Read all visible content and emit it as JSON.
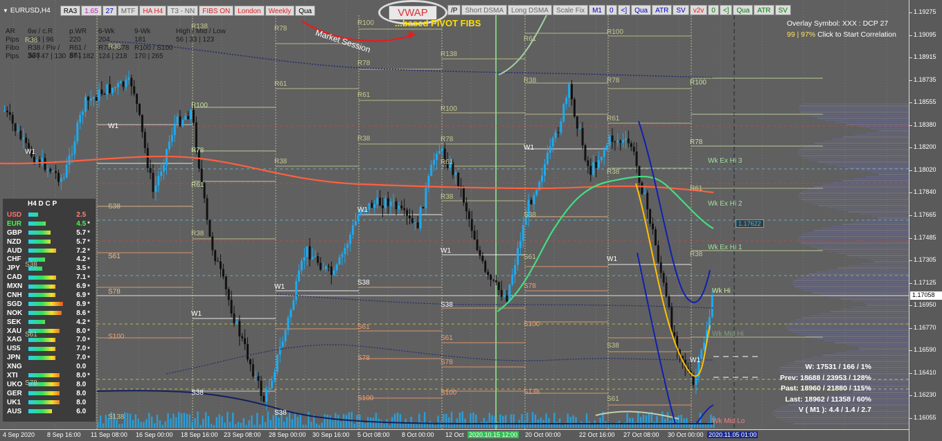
{
  "symbol": {
    "name": "EURUSD,H4"
  },
  "toolbar": {
    "items": [
      {
        "label": "RA3",
        "color": "#000000"
      },
      {
        "label": "1.65",
        "color": "#c020c0"
      },
      {
        "label": "27",
        "color": "#0000c0"
      },
      {
        "label": "MTF",
        "color": "#666666"
      },
      {
        "label": "HA H4",
        "color": "#e02020"
      },
      {
        "label": "T3 - NN",
        "color": "#666666"
      },
      {
        "label": "FIBS ON",
        "color": "#e02020"
      },
      {
        "label": "London",
        "color": "#e02020"
      },
      {
        "label": "Weekly",
        "color": "#e02020"
      },
      {
        "label": "Qua",
        "color": "#000000"
      }
    ],
    "items_right": [
      {
        "label": "/P",
        "color": "#000000"
      },
      {
        "label": "Short DSMA",
        "color": "#666666"
      },
      {
        "label": "Long DSMA",
        "color": "#666666"
      },
      {
        "label": "Scale Fix",
        "color": "#666666"
      },
      {
        "label": "M1",
        "color": "#0000c0"
      },
      {
        "label": "0",
        "color": "#0000c0"
      },
      {
        "label": "<]",
        "color": "#0000c0"
      },
      {
        "label": "Qua",
        "color": "#0000c0"
      },
      {
        "label": "ATR",
        "color": "#0000c0"
      },
      {
        "label": "SV",
        "color": "#0000c0"
      },
      {
        "label": "v2v",
        "color": "#e02020"
      },
      {
        "label": "0",
        "color": "#008000"
      },
      {
        "label": "<]",
        "color": "#008000"
      },
      {
        "label": "Qua",
        "color": "#008000"
      },
      {
        "label": "ATR",
        "color": "#008000"
      },
      {
        "label": "SV",
        "color": "#008000"
      }
    ],
    "vwap_label": "VWAP"
  },
  "annotations": {
    "market_session": "Market Session",
    "based_pivot": "...based PIVOT FIBS"
  },
  "overlay": {
    "line1": "Overlay Symbol: XXX : DCP 27",
    "line2_pct": "99 | 97%",
    "line2_text": "Click to Start Correlation"
  },
  "stats": {
    "rows": [
      [
        "AR",
        "6w / c.R",
        "p.WR",
        "6-Wk",
        "9-Wk",
        "High / Mid / Low"
      ],
      [
        "Pips",
        "R38 | 96",
        "220",
        "204",
        "181",
        "56 | 33 | 123"
      ],
      [
        "Fibo",
        "R38 / Piv / S38",
        "R61 / S61",
        "R78 / S78",
        "R100 / S100",
        ""
      ],
      [
        "Pips",
        "36 | 47 | 130",
        "87 | 182",
        "124 | 218",
        "170 | 265",
        ""
      ]
    ]
  },
  "dcp": {
    "header": "H4  D C P",
    "currencies": [
      {
        "name": "USD",
        "value": "2.5",
        "star": "",
        "name_color": "#ff7070",
        "fill": 0.25
      },
      {
        "name": "EUR",
        "value": "4.5",
        "star": "*",
        "name_color": "#40ff40",
        "fill": 0.45
      },
      {
        "name": "GBP",
        "value": "5.7",
        "star": "*",
        "name_color": "#ffffff",
        "fill": 0.57
      },
      {
        "name": "NZD",
        "value": "5.7",
        "star": "*",
        "name_color": "#ffffff",
        "fill": 0.57
      },
      {
        "name": "AUD",
        "value": "7.2",
        "star": "*",
        "name_color": "#ffffff",
        "fill": 0.72
      },
      {
        "name": "CHF",
        "value": "4.2",
        "star": "*",
        "name_color": "#ffffff",
        "fill": 0.42
      },
      {
        "name": "JPY",
        "value": "3.5",
        "star": "*",
        "name_color": "#ffffff",
        "fill": 0.35
      },
      {
        "name": "CAD",
        "value": "7.1",
        "star": "*",
        "name_color": "#ffffff",
        "fill": 0.71
      },
      {
        "name": "MXN",
        "value": "6.9",
        "star": "*",
        "name_color": "#ffffff",
        "fill": 0.69
      },
      {
        "name": "CNH",
        "value": "6.9",
        "star": "*",
        "name_color": "#ffffff",
        "fill": 0.69
      },
      {
        "name": "SGD",
        "value": "8.9",
        "star": "*",
        "name_color": "#ffffff",
        "fill": 0.89
      },
      {
        "name": "NOK",
        "value": "8.6",
        "star": "*",
        "name_color": "#ffffff",
        "fill": 0.86
      },
      {
        "name": "SEK",
        "value": "4.2",
        "star": "*",
        "name_color": "#ffffff",
        "fill": 0.42
      },
      {
        "name": "XAU",
        "value": "8.0",
        "star": "*",
        "name_color": "#ffffff",
        "fill": 0.8
      },
      {
        "name": "XAG",
        "value": "7.0",
        "star": "*",
        "name_color": "#ffffff",
        "fill": 0.7
      },
      {
        "name": "US5",
        "value": "7.0",
        "star": "*",
        "name_color": "#ffffff",
        "fill": 0.7
      },
      {
        "name": "JPN",
        "value": "7.0",
        "star": "*",
        "name_color": "#ffffff",
        "fill": 0.7
      },
      {
        "name": "XNG",
        "value": "0.0",
        "star": "",
        "name_color": "#ffffff",
        "fill": 0.0
      },
      {
        "name": "XTI",
        "value": "8.0",
        "star": "*",
        "name_color": "#ffffff",
        "fill": 0.8
      },
      {
        "name": "UKO",
        "value": "8.0",
        "star": "",
        "name_color": "#ffffff",
        "fill": 0.8
      },
      {
        "name": "GER",
        "value": "8.0",
        "star": "",
        "name_color": "#ffffff",
        "fill": 0.8
      },
      {
        "name": "UK1",
        "value": "8.0",
        "star": "",
        "name_color": "#ffffff",
        "fill": 0.8
      },
      {
        "name": "AUS",
        "value": "6.0",
        "star": "",
        "name_color": "#ffffff",
        "fill": 0.6
      }
    ]
  },
  "summary": {
    "w": "W: 17531 / 166 / 1%",
    "prev": "Prev: 18688 / 23953 / 128%",
    "past": "Past: 18960 / 21880 / 115%",
    "last": "Last: 18962 / 11358 / 60%",
    "v": "V ( M1 ): 4.4 / 1.4 / 2.7"
  },
  "price_axis": {
    "ticks": [
      "1.19275",
      "1.19095",
      "1.18915",
      "1.18735",
      "1.18555",
      "1.18380",
      "1.18200",
      "1.18020",
      "1.17840",
      "1.17665",
      "1.17485",
      "1.17305",
      "1.17125",
      "1.16950",
      "1.16770",
      "1.16590",
      "1.16410",
      "1.16230",
      "1.16055"
    ],
    "current_price": "1.17058",
    "marker_price": "1.17622"
  },
  "time_axis": {
    "labels": [
      "4 Sep 2020",
      "8 Sep 16:00",
      "11 Sep 08:00",
      "16 Sep 00:00",
      "18 Sep 16:00",
      "23 Sep 08:00",
      "28 Sep 00:00",
      "30 Sep 16:00",
      "5 Oct 08:00",
      "8 Oct 00:00",
      "12 Oct",
      "2020.10.15 12:00",
      "20 Oct 00:00",
      "22 Oct 16:00",
      "27 Oct 08:00",
      "30 Oct 00:00",
      "2020.11.05 01:00"
    ]
  },
  "pivot_labels": {
    "w1": "W1",
    "r38": "R38",
    "r61": "R61",
    "r78": "R78",
    "r100": "R100",
    "r138": "R138",
    "s38": "S38",
    "s61": "S61",
    "s78": "S78",
    "s100": "S100",
    "s138": "S138",
    "wk_ex_hi3": "Wk Ex Hi 3",
    "wk_ex_hi2": "Wk Ex Hi 2",
    "wk_ex_hi1": "Wk Ex Hi 1",
    "wk_hi": "Wk Hi",
    "wk_mid_hi": "Wk Mid Hi",
    "wk_mid_lo": "Wk Mid Lo"
  },
  "colors": {
    "bull": "#1eaaf0",
    "bear": "#111111",
    "ema": "#ff6040",
    "green_ma": "#40e080",
    "yellow": "#ffc000",
    "blue_band": "#1020b0",
    "pivot": "#c8c890"
  }
}
